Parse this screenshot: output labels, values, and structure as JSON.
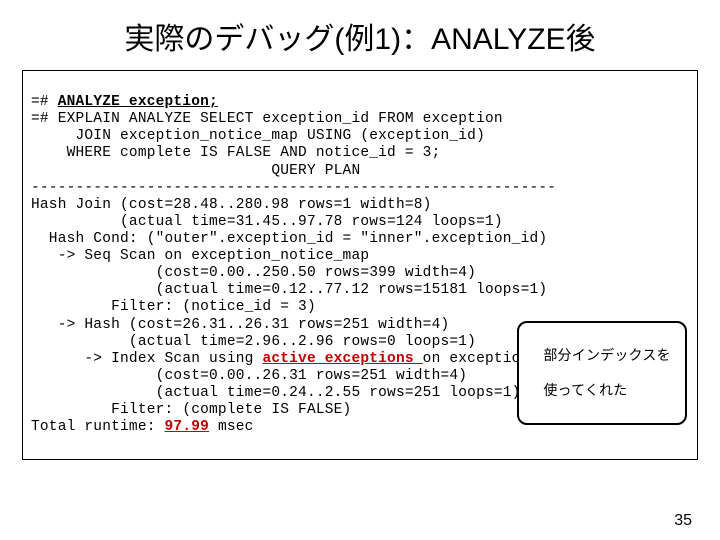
{
  "title": "実際のデバッグ(例1)：ANALYZE後",
  "callout": {
    "line1": "部分インデックスを",
    "line2": "使ってくれた"
  },
  "page_number": "35",
  "q": {
    "p0a": "=# ",
    "p0b": "ANALYZE exception;",
    "p1": "=# EXPLAIN ANALYZE SELECT exception_id FROM exception",
    "p2": "     JOIN exception_notice_map USING (exception_id)",
    "p3": "    WHERE complete IS FALSE AND notice_id = 3;",
    "p4": "                           QUERY PLAN",
    "p5": "-----------------------------------------------------------",
    "l1": "Hash Join (cost=28.48..280.98 rows=1 width=8)",
    "l2": "          (actual time=31.45..97.78 rows=124 loops=1)",
    "l3": "  Hash Cond: (\"outer\".exception_id = \"inner\".exception_id)",
    "l4": "   -> Seq Scan on exception_notice_map",
    "l5": "              (cost=0.00..250.50 rows=399 width=4)",
    "l6": "              (actual time=0.12..77.12 rows=15181 loops=1)",
    "l7": "         Filter: (notice_id = 3)",
    "l8": "   -> Hash (cost=26.31..26.31 rows=251 width=4)",
    "l9": "           (actual time=2.96..2.96 rows=0 loops=1)",
    "l10a": "      -> Index Scan using ",
    "l10b": "active_exceptions ",
    "l10c": "on exception",
    "l11": "              (cost=0.00..26.31 rows=251 width=4)",
    "l12": "              (actual time=0.24..2.55 rows=251 loops=1)",
    "l13": "         Filter: (complete IS FALSE)",
    "l14a": "Total runtime: ",
    "l14b": "97.99",
    "l14c": " msec"
  }
}
